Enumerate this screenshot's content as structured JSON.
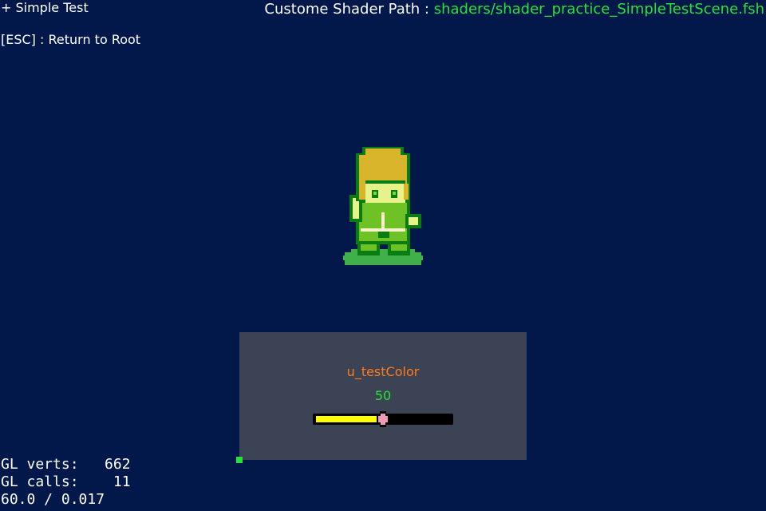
{
  "header": {
    "title": "+ Simple Test",
    "esc_hint": "[ESC] : Return to Root",
    "shader_label": "Custome Shader Path : ",
    "shader_path": "shaders/shader_practice_SimpleTestScene.fsh"
  },
  "panel": {
    "uniform_name": "u_testColor",
    "value_text": "50",
    "slider_percent": 50
  },
  "stats": {
    "verts": "GL verts:   662",
    "calls": "GL calls:    11",
    "fps": "60.0 / 0.017"
  },
  "colors": {
    "background": "#02174a",
    "panel": "#3c4354",
    "accent_green": "#27e23a",
    "uniform_orange": "#ff7a1a",
    "slider_fill": "#ffff00",
    "slider_thumb": "#ef9bb8"
  },
  "sprite": {
    "icon": "character-sprite"
  }
}
